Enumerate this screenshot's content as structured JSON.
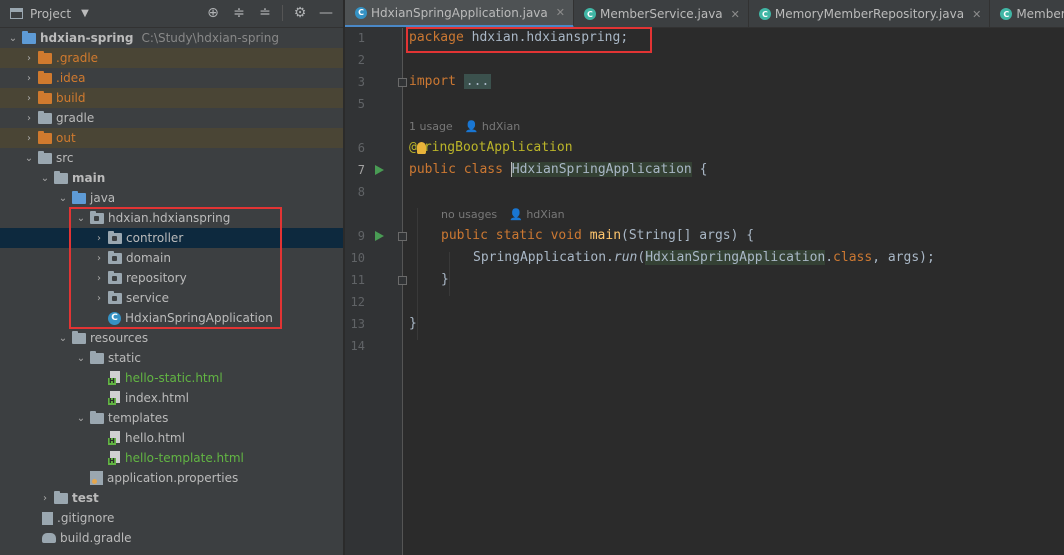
{
  "project_pane": {
    "title": "Project",
    "tree": [
      {
        "label": "hdxian-spring",
        "path": "C:\\Study\\hdxian-spring"
      },
      {
        "label": ".gradle"
      },
      {
        "label": ".idea"
      },
      {
        "label": "build"
      },
      {
        "label": "gradle"
      },
      {
        "label": "out"
      },
      {
        "label": "src"
      },
      {
        "label": "main"
      },
      {
        "label": "java"
      },
      {
        "label": "hdxian.hdxianspring"
      },
      {
        "label": "controller"
      },
      {
        "label": "domain"
      },
      {
        "label": "repository"
      },
      {
        "label": "service"
      },
      {
        "label": "HdxianSpringApplication"
      },
      {
        "label": "resources"
      },
      {
        "label": "static"
      },
      {
        "label": "hello-static.html"
      },
      {
        "label": "index.html"
      },
      {
        "label": "templates"
      },
      {
        "label": "hello.html"
      },
      {
        "label": "hello-template.html"
      },
      {
        "label": "application.properties"
      },
      {
        "label": "test"
      },
      {
        "label": ".gitignore"
      },
      {
        "label": "build.gradle"
      }
    ]
  },
  "tabs": [
    {
      "label": "HdxianSpringApplication.java"
    },
    {
      "label": "MemberService.java"
    },
    {
      "label": "MemoryMemberRepository.java"
    },
    {
      "label": "MemberServiceTest."
    }
  ],
  "editor": {
    "line_numbers": [
      "1",
      "2",
      "3",
      "5",
      "6",
      "7",
      "8",
      "9",
      "10",
      "11",
      "12",
      "13",
      "14"
    ],
    "code": {
      "pkg_kw": "package",
      "pkg_name": " hdxian.hdxianspring;",
      "import_kw": "import",
      "import_fold": "...",
      "usage1_count": "1 usage",
      "usage1_author": "hdXian",
      "ann_at": "@",
      "ann_rest": "ringBootApplication",
      "class_kw": "public class ",
      "class_name": "HdxianSpringApplication",
      "class_brace": " {",
      "usage2_count": "no usages",
      "usage2_author": "hdXian",
      "main_kw": "public static void ",
      "main_name": "main",
      "main_params": "(String[] args) {",
      "call_obj": "SpringApplication.",
      "call_method": "run",
      "call_arg_open": "(",
      "call_arg_class": "HdxianSpringApplication",
      "call_dot": ".",
      "call_class_kw": "class",
      "call_rest": ", args);",
      "close_inner": "}",
      "close_outer": "}"
    }
  },
  "colors": {
    "keyword": "#cc7832",
    "annotation": "#bbb529",
    "method": "#ffc66d",
    "highlight": "#e23434",
    "green_file": "#62b543",
    "excluded_folder": "#d07a2e"
  }
}
